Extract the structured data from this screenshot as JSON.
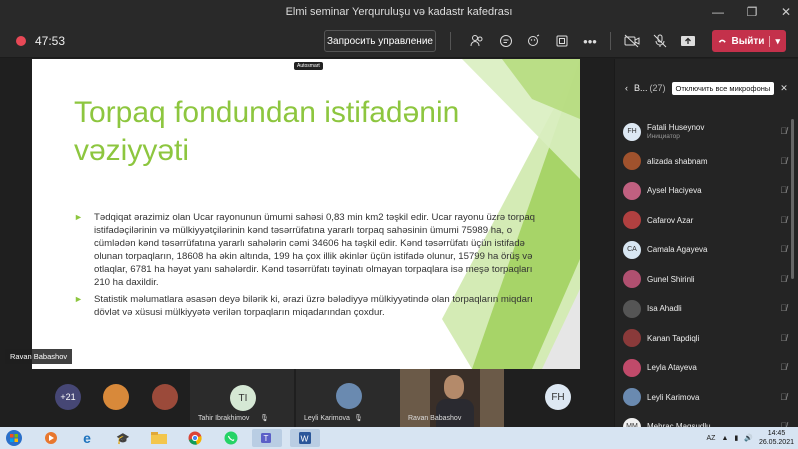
{
  "window": {
    "title": "Elmi seminar Yerquruluşu və kadastr kafedrası",
    "controls": [
      "—",
      "❐",
      "✕"
    ]
  },
  "toolbar": {
    "timer": "47:53",
    "share_label": "Запросить управление",
    "leave_label": "Выйти",
    "record_color": "#e74856",
    "leave_color": "#c4314b"
  },
  "slide": {
    "badge": "Autosmart",
    "title": "Torpaq fondundan istifadənin vəziyyəti",
    "accent": "#8dc63f",
    "bullets": [
      "Tədqiqat ərazimiz olan Ucar rayonunun ümumi sahəsi 0,83 min km2 təşkil edir. Ucar rayonu üzrə torpaq istifadəçilərinin və mülkiyyətçilərinin kənd təsərrüfatına yararlı torpaq sahəsinin ümumi 75989 ha, o cümlədən kənd təsərrüfatına yararlı sahələrin cəmi 34606 ha təşkil edir. Kənd təsərrüfatı üçün istifadə olunan torpaqların, 18608 ha əkin altında, 199 ha çox illik əkinlər üçün istifadə olunur, 15799 ha örüş və otlaqlar, 6781 ha həyət yanı sahələrdir. Kənd təsərrüfatı təyinatı olmayan torpaqlara isə meşə torpaqları 210 ha daxildir.",
      "Statistik məlumatlara əsasən deyə bilərik ki, ərazi üzrə bələdiyyə mülkiyyətində olan torpaqların miqdarı dövlət və xüsusi mülkiyyətə verilən torpaqların miqadarından çoxdur."
    ],
    "presenter": "Ravan Babashov"
  },
  "strip": {
    "more": "+21",
    "tiles": [
      {
        "initials": "TI",
        "name": "Tahir Ibrakhimov"
      },
      {
        "initials": "",
        "name": "Leyli Karimova"
      },
      {
        "initials": "",
        "name": "Ravan Babashov"
      },
      {
        "initials": "FH",
        "name": ""
      }
    ]
  },
  "panel": {
    "title": "B...",
    "count": "(27)",
    "mute_all": "Отключить все микрофоны",
    "participants": [
      {
        "initials": "FH",
        "name": "Fatali Huseynov",
        "role": "Инициатор",
        "color": "#dde8f3"
      },
      {
        "initials": "",
        "name": "alizada shabnam",
        "role": "",
        "color": "#a0522d"
      },
      {
        "initials": "",
        "name": "Aysel Haciyeva",
        "role": "",
        "color": "#c06080"
      },
      {
        "initials": "",
        "name": "Cafarov Azar",
        "role": "",
        "color": "#b04040"
      },
      {
        "initials": "CA",
        "name": "Camala Agayeva",
        "role": "",
        "color": "#d8e6f2"
      },
      {
        "initials": "",
        "name": "Gunel Shirinli",
        "role": "",
        "color": "#b05070"
      },
      {
        "initials": "",
        "name": "Isa Ahadli",
        "role": "",
        "color": "#555555"
      },
      {
        "initials": "",
        "name": "Kanan Tapdiqli",
        "role": "",
        "color": "#8a3a3a"
      },
      {
        "initials": "",
        "name": "Leyla Atayeva",
        "role": "",
        "color": "#c04a6a"
      },
      {
        "initials": "",
        "name": "Leyli Karimova",
        "role": "",
        "color": "#6a8ab0"
      },
      {
        "initials": "MM",
        "name": "Mehrac Maqsudlu",
        "role": "",
        "color": "#f0f0f0"
      }
    ]
  },
  "taskbar": {
    "lang": "AZ",
    "time": "14:45",
    "date": "26.05.2021"
  }
}
